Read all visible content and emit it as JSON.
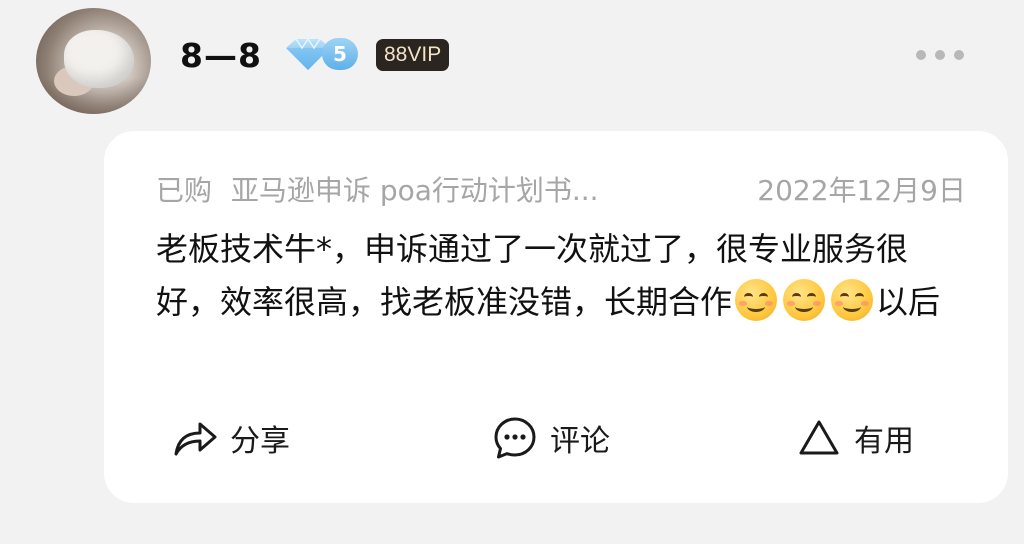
{
  "user": {
    "name": "8—8",
    "level": "5",
    "vip_label": "88VIP"
  },
  "review": {
    "purchased_label": "已购",
    "product": "亚马逊申诉 poa行动计划书...",
    "date": "2022年12月9日",
    "text_before_emoji": "老板技术牛*，申诉通过了一次就过了，很专业服务很好，效率很高，找老板准没错，长期合作",
    "text_after_emoji": "以后"
  },
  "actions": {
    "share_label": "分享",
    "comment_label": "评论",
    "useful_label": "有用"
  },
  "icons": {
    "level": "diamond-icon",
    "more": "more-dots-icon",
    "share": "share-arrow-icon",
    "comment": "comment-bubble-icon",
    "useful": "triangle-icon",
    "emoji": "smiling-face-emoji"
  },
  "colors": {
    "background": "#f2f2f2",
    "card": "#ffffff",
    "meta_text": "#a6a6a6",
    "diamond": "#5eb0ea",
    "vip_badge": "#2a2520"
  }
}
